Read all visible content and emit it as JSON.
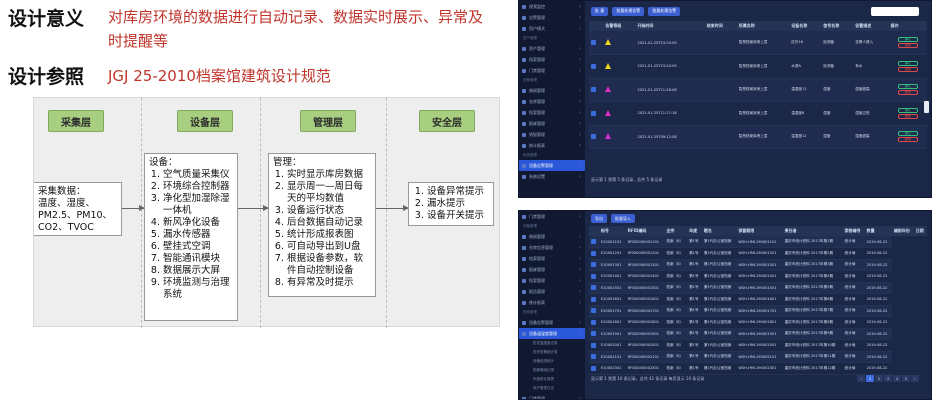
{
  "slide": {
    "heading1": "设计意义",
    "heading1_text": "对库房环境的数据进行自动记录、数据实时展示、异常及时提醒等",
    "heading2": "设计参照",
    "heading2_text": "JGJ 25-2010档案馆建筑设计规范"
  },
  "diagram": {
    "lanes": [
      "采集层",
      "设备层",
      "管理层",
      "安全层"
    ],
    "collect_title": "采集数据：",
    "collect_lines": [
      "温度、湿度、",
      "PM2.5、PM10、",
      "CO2、TVOC"
    ],
    "device_title": "设备：",
    "device_items": [
      "空气质量采集仪",
      "环境综合控制器",
      "净化型加湿除湿一体机",
      "新风净化设备",
      "漏水传感器",
      "壁挂式空调",
      "智能通讯模块",
      "数据展示大屏",
      "环境监测与治理系统"
    ],
    "manage_title": "管理：",
    "manage_items": [
      "实时显示库房数据",
      "显示周一—周日每天的平均数值",
      "设备运行状态",
      "后台数据自动记录",
      "统计形成报表图",
      "可自动导出到U盘",
      "根据设备参数，软件自动控制设备",
      "有异常及时提示"
    ],
    "safety_items": [
      "设备异常提示",
      "漏水提示",
      "设备开关提示"
    ]
  },
  "screen1": {
    "sidebar": [
      {
        "label": "视频监控",
        "type": "item"
      },
      {
        "label": "告警管理",
        "type": "item"
      },
      {
        "label": "用户模式",
        "type": "item"
      },
      {
        "label": "资产管理",
        "type": "head"
      },
      {
        "label": "资产管理",
        "type": "item"
      },
      {
        "label": "档案管理",
        "type": "item"
      },
      {
        "label": "门禁管理",
        "type": "item"
      },
      {
        "label": "设备管理",
        "type": "head"
      },
      {
        "label": "借阅管理",
        "type": "item"
      },
      {
        "label": "仓库管理",
        "type": "item"
      },
      {
        "label": "档案管理",
        "type": "item"
      },
      {
        "label": "报废管理",
        "type": "item"
      },
      {
        "label": "销毁管理",
        "type": "item"
      },
      {
        "label": "统计报表",
        "type": "item"
      },
      {
        "label": "系统管理",
        "type": "head"
      },
      {
        "label": "设备告警管理",
        "type": "active"
      },
      {
        "label": "系统设置",
        "type": "item"
      }
    ],
    "buttons": [
      "批 量",
      "批量处理告警",
      "批量处理告警"
    ],
    "search_placeholder": "",
    "columns": [
      "",
      "告警等级",
      "开始时间",
      "结束时间",
      "所属名称",
      "设备名称",
      "信号名称",
      "告警描述",
      "操作"
    ],
    "rows": [
      {
        "level": "yellow",
        "start": "2021-01-25T23:20:09",
        "end": "",
        "place": "智慧档案库房上层",
        "device": "红外16",
        "signal": "检测值",
        "desc": "告警人侵入"
      },
      {
        "level": "yellow",
        "start": "2021-01-25T23:20:09",
        "end": "",
        "place": "智慧档案库房上层",
        "device": "水浸&",
        "signal": "检测值",
        "desc": "有水"
      },
      {
        "level": "magenta",
        "start": "2021-01-25T11:28:08",
        "end": "",
        "place": "智慧档案库房上层",
        "device": "温湿度11",
        "signal": "湿度",
        "desc": "湿度超高"
      },
      {
        "level": "magenta",
        "start": "2021-01-25T11:27:18",
        "end": "",
        "place": "智慧档案库房上层",
        "device": "温湿度8",
        "signal": "湿度",
        "desc": "湿度过低"
      },
      {
        "level": "magenta",
        "start": "2021-01-25T09:12:08",
        "end": "",
        "place": "智慧档案库房上层",
        "device": "温湿度12",
        "signal": "湿度",
        "desc": "湿度超高"
      }
    ],
    "op_labels": [
      "确认",
      "删除"
    ],
    "footer": "显示第 1 到第 5 条记录，总共 5 条记录"
  },
  "screen2": {
    "sidebar": [
      {
        "label": "门禁管理",
        "type": "item"
      },
      {
        "label": "设备管理",
        "type": "head"
      },
      {
        "label": "借阅管理",
        "type": "item"
      },
      {
        "label": "仓库信息管理",
        "type": "item"
      },
      {
        "label": "档案管理",
        "type": "item"
      },
      {
        "label": "报废管理",
        "type": "item"
      },
      {
        "label": "档案管理",
        "type": "item"
      },
      {
        "label": "报告管理",
        "type": "item"
      },
      {
        "label": "统计报表",
        "type": "item"
      },
      {
        "label": "系统管理",
        "type": "head"
      },
      {
        "label": "设备告警管理",
        "type": "item"
      },
      {
        "label": "设备温湿度管理",
        "type": "active"
      },
      {
        "label": "历史温湿度记录",
        "type": "sub"
      },
      {
        "label": "历史告警统计表",
        "type": "sub"
      },
      {
        "label": "设备检测统计",
        "type": "sub"
      },
      {
        "label": "档案借阅记录",
        "type": "sub"
      },
      {
        "label": "年度统计报表",
        "type": "sub"
      },
      {
        "label": "用户登录日志",
        "type": "sub"
      },
      {
        "label": "门禁管理",
        "type": "item"
      },
      {
        "label": "系统设置",
        "type": "item"
      }
    ],
    "buttons": [
      "导出",
      "批量导入"
    ],
    "columns": [
      "",
      "档号",
      "RFID编码",
      "全宗",
      "年度",
      "题名",
      "保管期限",
      "责任者",
      "案卷编号",
      "数量",
      "编制年份",
      "日期"
    ],
    "rows": [
      [
        "E10001101",
        "RFID0000001101",
        "档案（8）",
        "第1号",
        "第1代办公室档案",
        "WSH-HML190001101",
        "重庆市统计资料 2017年第1期",
        "统计局",
        "2019-08-22"
      ],
      [
        "E10001201",
        "RFID0000001201",
        "档案（8）",
        "第1号",
        "第1代办公室档案",
        "WSH-HML190001201",
        "重庆市统计资料 2017年第2期",
        "统计局",
        "2019-08-22"
      ],
      [
        "E10001301",
        "RFID0000001301",
        "档案（8）",
        "第1号",
        "第1代办公室档案",
        "WSH-HML190001301",
        "重庆市统计资料 2017年第3期",
        "统计局",
        "2019-08-22"
      ],
      [
        "E10001401",
        "RFID0000001401",
        "档案（8）",
        "第1号",
        "第1代办公室档案",
        "WSH-HML190001401",
        "重庆市统计资料 2017年第4期",
        "统计局",
        "2019-08-22"
      ],
      [
        "E10001501",
        "RFID0000001501",
        "档案（8）",
        "第1号",
        "第1代办公室档案",
        "WSH-HML190001501",
        "重庆市统计资料 2017年第5期",
        "统计局",
        "2019-08-22"
      ],
      [
        "E10001601",
        "RFID0000001601",
        "档案（8）",
        "第1号",
        "第1代办公室档案",
        "WSH-HML190001601",
        "重庆市统计资料 2017年第6期",
        "统计局",
        "2019-08-22"
      ],
      [
        "E10001701",
        "RFID0000001701",
        "档案（8）",
        "第1号",
        "第1代办公室档案",
        "WSH-HML190001701",
        "重庆市统计资料 2017年第7期",
        "统计局",
        "2019-08-22"
      ],
      [
        "E10001801",
        "RFID0000001801",
        "档案（8）",
        "第1号",
        "第1代办公室档案",
        "WSH-HML190001801",
        "重庆市统计资料 2017年第8期",
        "统计局",
        "2019-08-22"
      ],
      [
        "E10001901",
        "RFID0000001901",
        "档案（8）",
        "第1号",
        "第1代办公室档案",
        "WSH-HML190001901",
        "重庆市统计资料 2017年第9期",
        "统计局",
        "2019-08-22"
      ],
      [
        "E10002001",
        "RFID0000002001",
        "档案（8）",
        "第1号",
        "第1代办公室档案",
        "WSH-HML190002001",
        "重庆市统计资料 2017年第10期",
        "统计局",
        "2019-08-22"
      ],
      [
        "E10002101",
        "RFID0000002101",
        "档案（8）",
        "第1号",
        "第1代办公室档案",
        "WSH-HML190002101",
        "重庆市统计资料 2017年第11期",
        "统计局",
        "2019-08-22"
      ],
      [
        "E10002301",
        "RFID0000002301",
        "档案（8）",
        "第1号",
        "第1代办公室档案",
        "WSH-HML190002301",
        "重庆市统计资料 2017年第12期",
        "统计局",
        "2019-08-22"
      ]
    ],
    "footer": "显示第 1 到第 10 条记录，总共 42 条记录 每页显示 10 条记录",
    "pages": [
      "‹",
      "1",
      "2",
      "3",
      "4",
      "5",
      "›"
    ]
  },
  "colors": {
    "accent": "#3b6de0",
    "slide_red": "#c0352c",
    "lane_green": "#a7cf7f",
    "panel_bg": "#1b2747"
  }
}
